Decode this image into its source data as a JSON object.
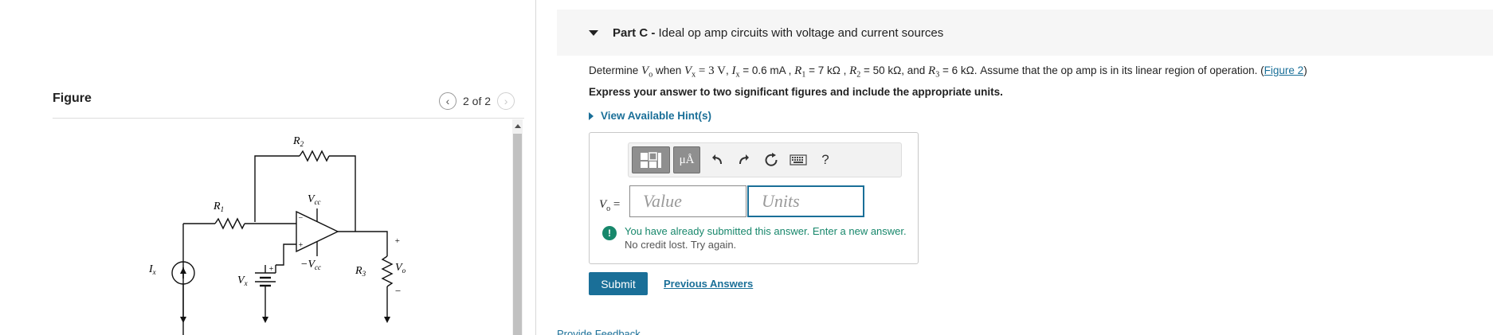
{
  "figure_panel": {
    "title": "Figure",
    "pager_text": "2 of 2",
    "prev_icon": "chevron-left-icon",
    "next_icon": "chevron-right-icon",
    "circuit_labels": {
      "r2": "R",
      "r2_sub": "2",
      "r1": "R",
      "r1_sub": "1",
      "r3": "R",
      "r3_sub": "3",
      "vcc_top": "V",
      "vcc_top_sub": "cc",
      "vcc_bottom": "−V",
      "vcc_bottom_sub": "cc",
      "ix": "I",
      "ix_sub": "x",
      "vx": "V",
      "vx_sub": "x",
      "vo": "V",
      "vo_sub": "o",
      "plus": "+",
      "minus": "−"
    }
  },
  "part": {
    "letter": "Part C -",
    "title": "Ideal op amp circuits with voltage and current sources",
    "caret_icon": "caret-down-icon"
  },
  "question": {
    "t1": "Determine ",
    "vo": "V",
    "vo_sub": "o",
    "t2": " when ",
    "vx": "V",
    "vx_sub": "x",
    "vx_val": " = 3 V",
    "t3": ", ",
    "ix": "I",
    "ix_sub": "x",
    "ix_val": " = 0.6 mA",
    "t4": " , ",
    "r1": "R",
    "r1_sub": "1",
    "r1_val": " = 7 kΩ",
    "t5": " , ",
    "r2": "R",
    "r2_sub": "2",
    "r2_val": " = 50 kΩ",
    "t6": ", and ",
    "r3": "R",
    "r3_sub": "3",
    "r3_val": " = 6 kΩ",
    "t7": ". Assume that the op amp is in its linear region of operation. (",
    "figure_link": "Figure 2",
    "t8": ")"
  },
  "instruction": "Express your answer to two significant figures and include the appropriate units.",
  "hint_toggle": "View Available Hint(s)",
  "toolbar": {
    "template_icon": "templates-icon",
    "units_label": "μÅ",
    "undo_icon": "undo-icon",
    "redo_icon": "redo-icon",
    "reset_icon": "reset-icon",
    "keyboard_icon": "keyboard-icon",
    "help_label": "?"
  },
  "answer": {
    "label_var": "V",
    "label_sub": "o",
    "label_eq": " =",
    "value_placeholder": "Value",
    "units_placeholder": "Units"
  },
  "alert": {
    "icon": "!",
    "message": "You have already submitted this answer. Enter a new answer.",
    "sub": "No credit lost. Try again."
  },
  "submit_label": "Submit",
  "previous_answers_label": "Previous Answers",
  "feedback_label": "Provide Feedback",
  "colors": {
    "accent": "#1a6f98",
    "success": "#17876b"
  }
}
